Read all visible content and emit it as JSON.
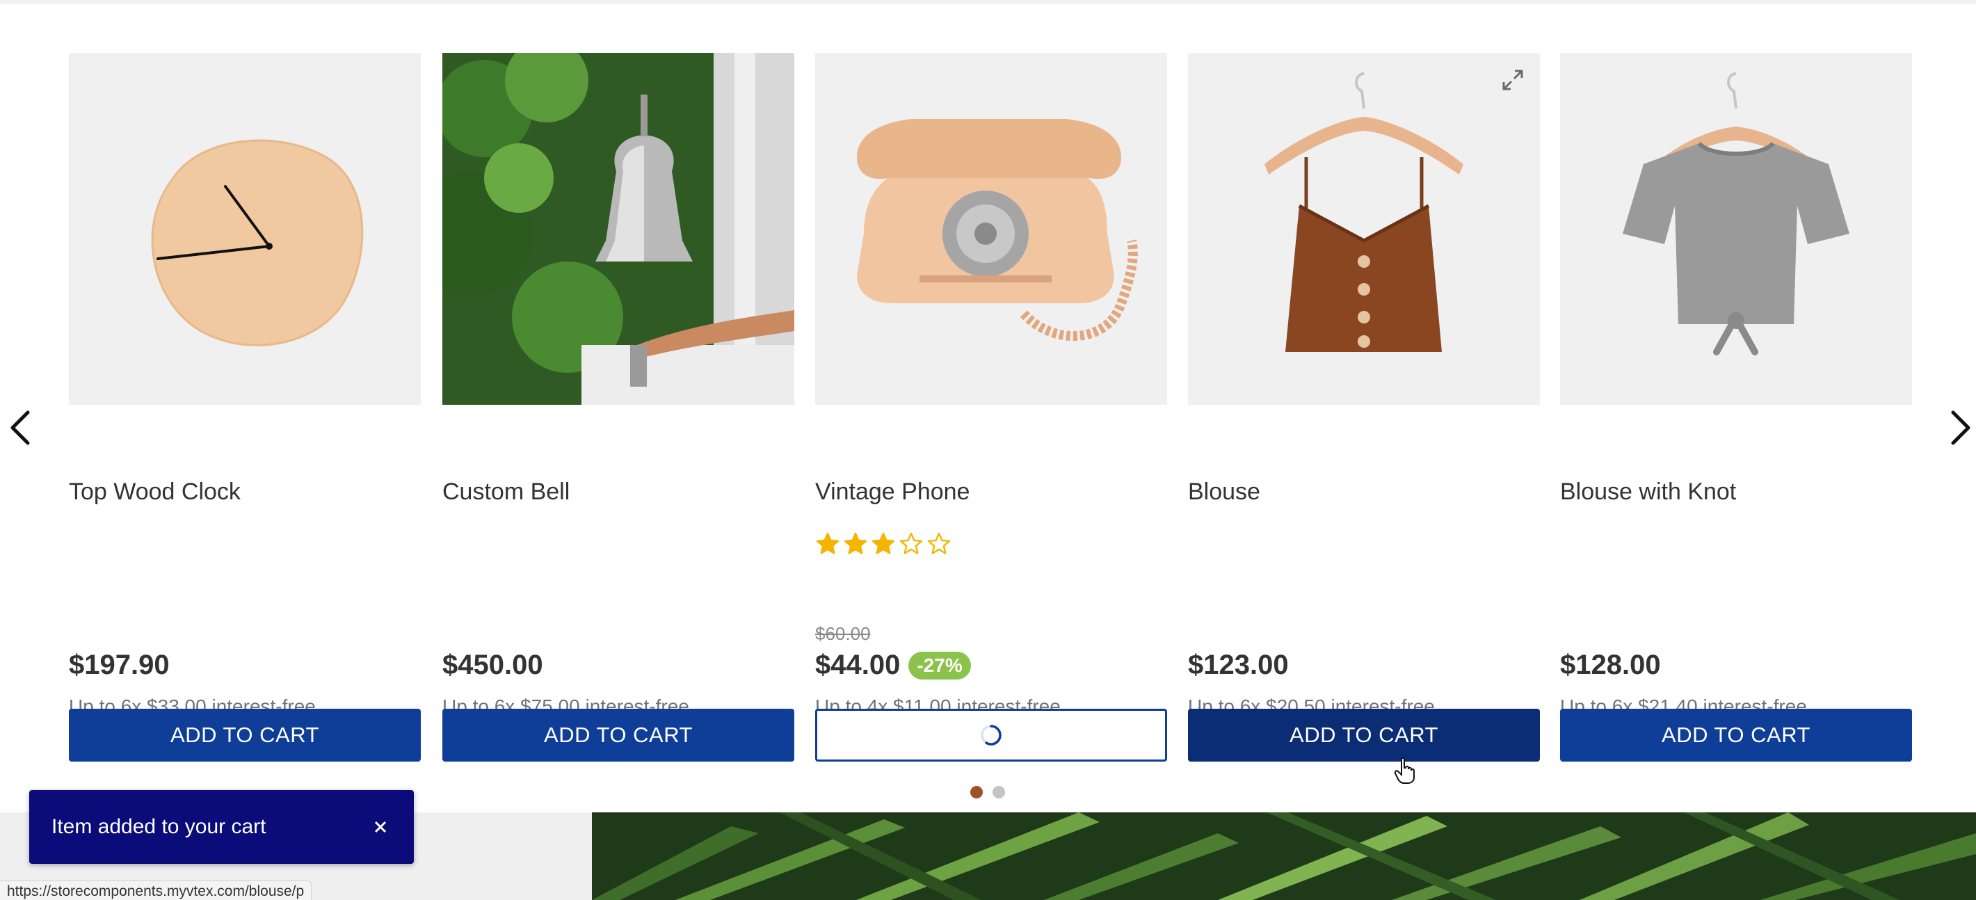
{
  "shelf": {
    "prev_arrow": "chevron-left-icon",
    "next_arrow": "chevron-right-icon",
    "products": [
      {
        "name": "Top Wood Clock",
        "price": "$197.90",
        "installments": "Up to 6x $33.00 interest-free",
        "button_label": "ADD TO CART",
        "button_state": "default"
      },
      {
        "name": "Custom Bell",
        "price": "$450.00",
        "installments": "Up to 6x $75.00 interest-free",
        "button_label": "ADD TO CART",
        "button_state": "default"
      },
      {
        "name": "Vintage Phone",
        "rating": 3,
        "rating_max": 5,
        "list_price": "$60.00",
        "price": "$44.00",
        "discount": "-27%",
        "installments": "Up to 4x $11.00 interest-free",
        "button_state": "loading"
      },
      {
        "name": "Blouse",
        "price": "$123.00",
        "installments": "Up to 6x $20.50 interest-free",
        "button_label": "ADD TO CART",
        "button_state": "hover"
      },
      {
        "name": "Blouse with Knot",
        "price": "$128.00",
        "installments": "Up to 6x $21.40 interest-free",
        "button_label": "ADD TO CART",
        "button_state": "default"
      }
    ],
    "pagination": {
      "pages": 2,
      "active": 1
    }
  },
  "toast": {
    "message": "Item added to your cart",
    "close_icon": "close-icon"
  },
  "status_bar": {
    "url": "https://storecomponents.myvtex.com/blouse/p"
  },
  "colors": {
    "button": "#0f3e99",
    "button_hover": "#0a2d76",
    "discount_badge": "#8bc34a",
    "star": "#f4b400",
    "toast": "#0b0b7a",
    "dot_active": "#a1502a"
  }
}
